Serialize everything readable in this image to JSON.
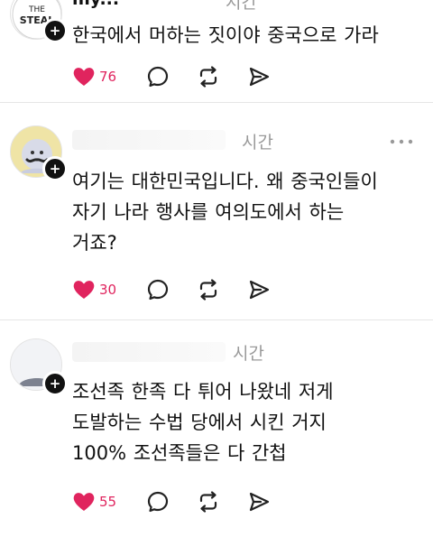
{
  "posts": [
    {
      "username": "my...",
      "time": "시간",
      "text": "한국에서 머하는 짓이야 중국으로 가라",
      "likes": "76",
      "avatar_text": "THE STEAL"
    },
    {
      "time": "시간",
      "text": "여기는 대한민국입니다. 왜 중국인들이\n자기 나라 행사를 여의도에서 하는\n거죠?",
      "likes": "30"
    },
    {
      "time": "시간",
      "text": "조선족  한족  다  튀어  나왔네  저게\n도발하는  수법  당에서  시킨  거지\n100%  조선족들은  다  간첩",
      "likes": "55"
    }
  ],
  "colors": {
    "heart": "#e0245e",
    "divider": "#e6e6e6"
  },
  "icons": [
    "heart-icon",
    "comment-icon",
    "repost-icon",
    "share-icon",
    "more-icon",
    "follow-plus-icon"
  ]
}
